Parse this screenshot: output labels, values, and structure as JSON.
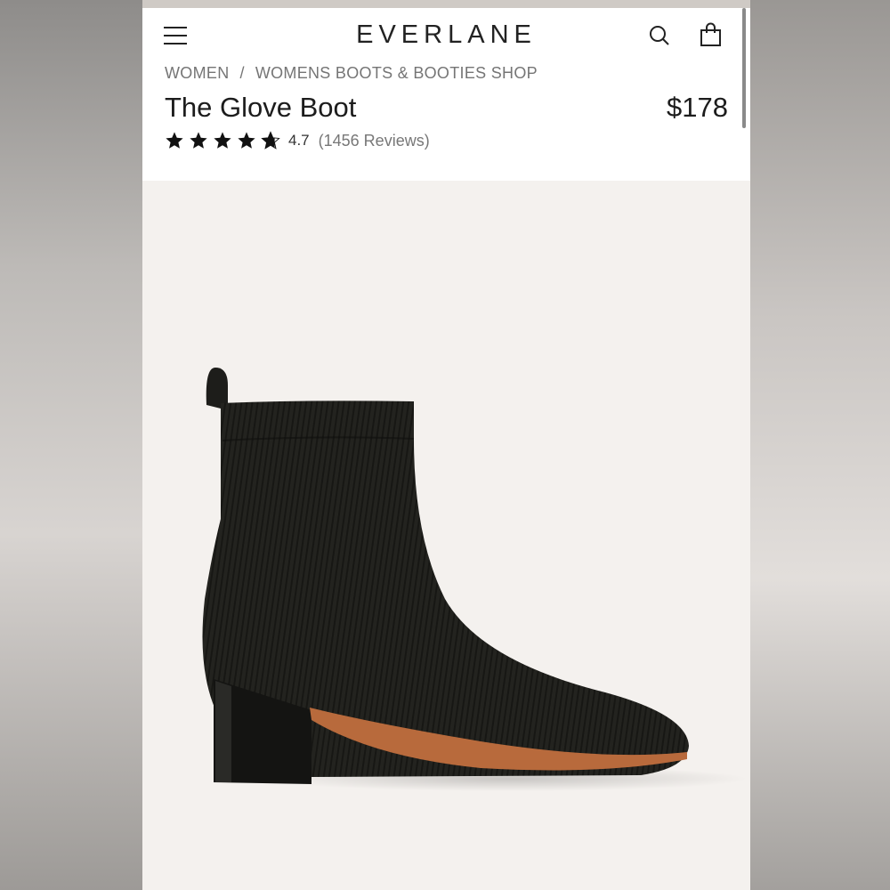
{
  "header": {
    "logo": "EVERLANE",
    "icons": [
      "menu-icon",
      "search-icon",
      "bag-icon"
    ]
  },
  "breadcrumb": {
    "items": [
      "WOMEN",
      "WOMENS BOOTS & BOOTIES SHOP"
    ],
    "separator": "/"
  },
  "product": {
    "title": "The Glove Boot",
    "price": "$178",
    "rating": "4.7",
    "reviews": "(1456 Reviews)",
    "star_fill": 4.7,
    "image": "boot-image"
  },
  "colors": {
    "background": "#f4f1ee",
    "header_bg": "#ffffff",
    "text": "#1c1c1c",
    "muted": "#757575",
    "boot": "#1f1f1b",
    "sole": "#b86a3c"
  }
}
